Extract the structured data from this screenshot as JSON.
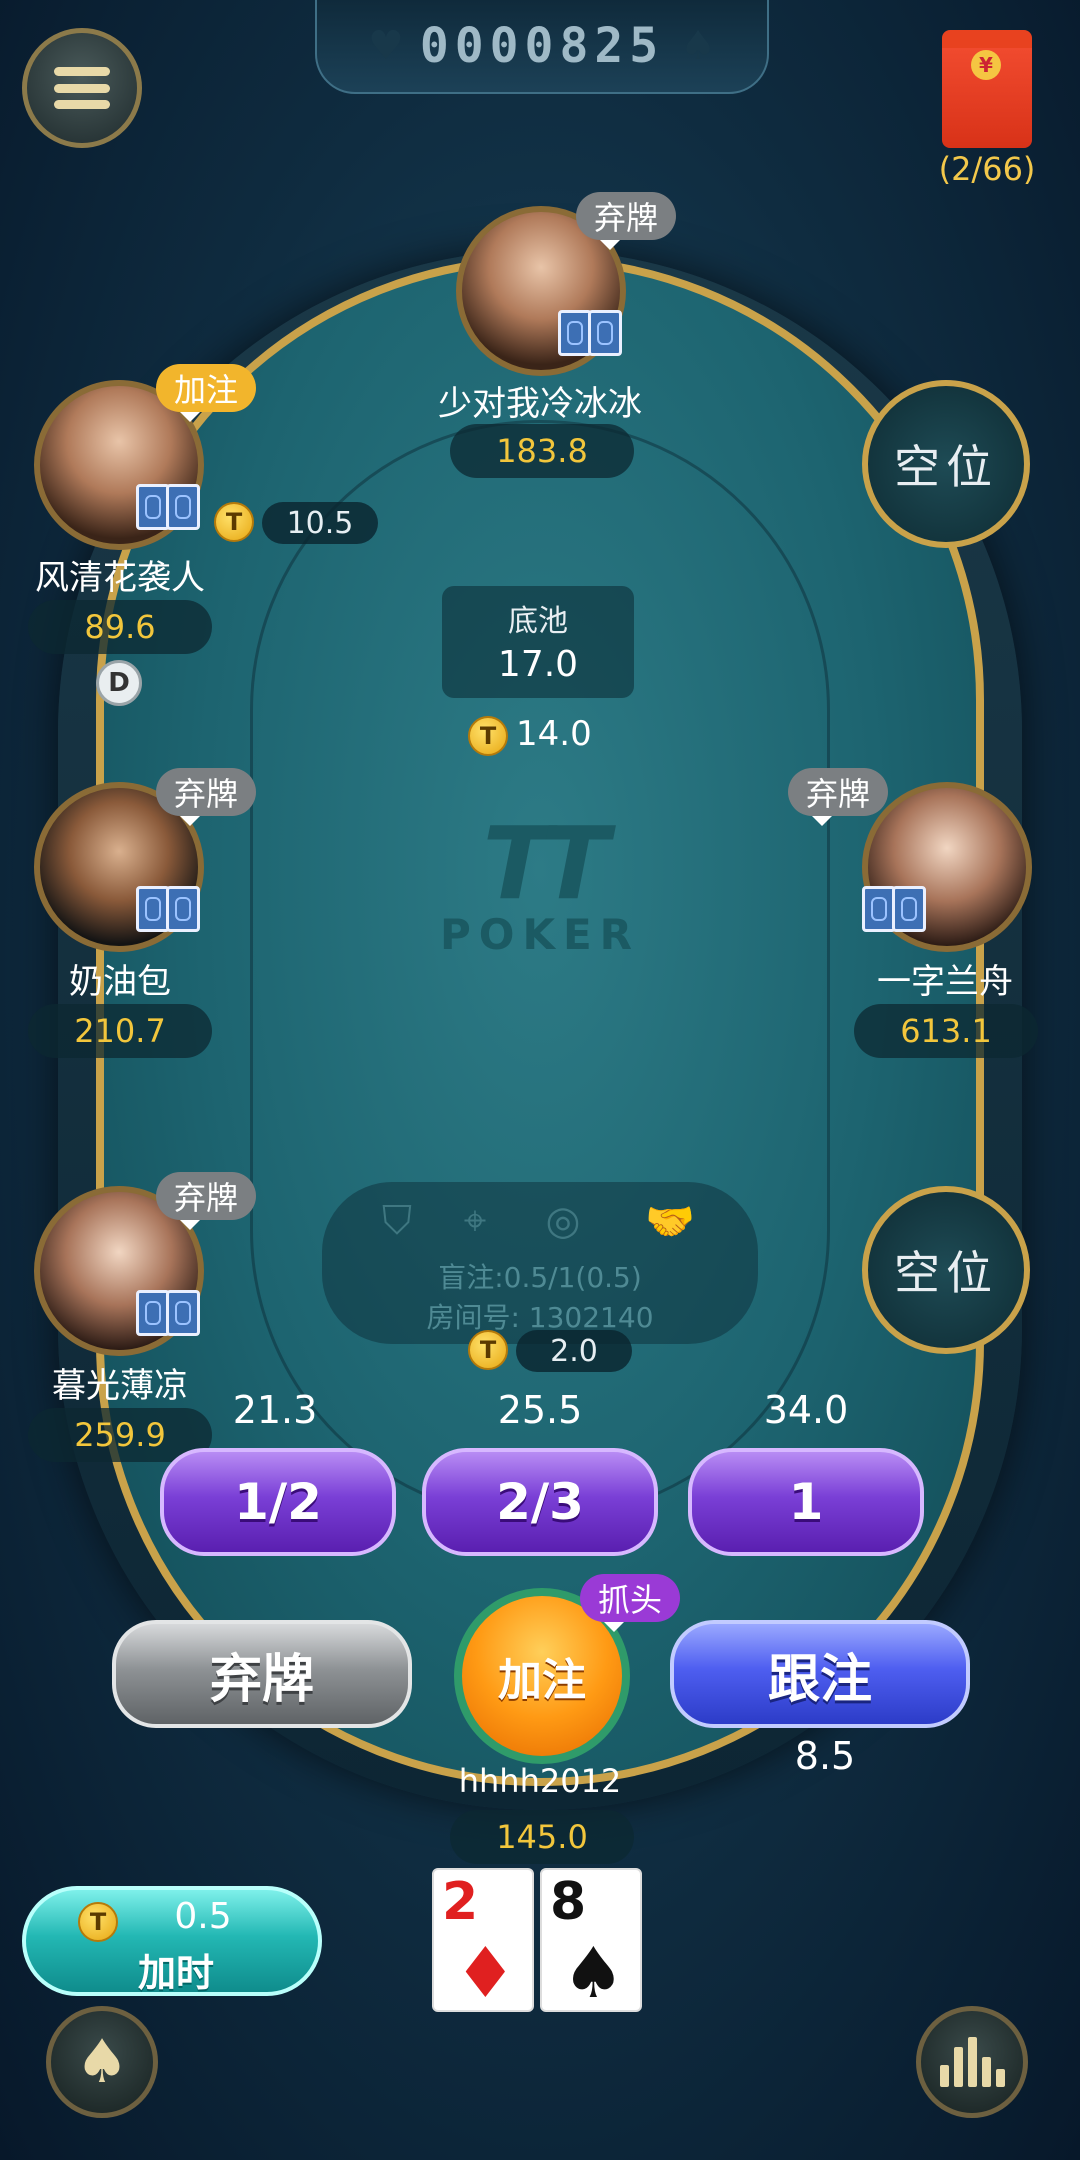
{
  "header": {
    "room_counter": "0000825",
    "red_packet_count": "(2/66)"
  },
  "seats": {
    "top": {
      "name": "少对我冷冰冰",
      "chips": "183.8",
      "status": "弃牌"
    },
    "left1": {
      "name": "风清花袭人",
      "chips": "89.6",
      "status": "加注",
      "bet": "10.5",
      "dealer": "D"
    },
    "left2": {
      "name": "奶油包",
      "chips": "210.7",
      "status": "弃牌"
    },
    "left3": {
      "name": "暮光薄凉",
      "chips": "259.9",
      "status": "弃牌"
    },
    "right2": {
      "name": "一字兰舟",
      "chips": "613.1",
      "status": "弃牌"
    },
    "empty_label": "空位"
  },
  "pot": {
    "label": "底池",
    "value": "17.0",
    "current_bet": "14.0"
  },
  "logo": {
    "tt": "TT",
    "poker": "POKER"
  },
  "room_info": {
    "blinds": "盲注:0.5/1(0.5)",
    "room_number": "房间号: 1302140"
  },
  "my_bet": "2.0",
  "raise_options": [
    {
      "label": "1/2",
      "amount": "21.3"
    },
    {
      "label": "2/3",
      "amount": "25.5"
    },
    {
      "label": "1",
      "amount": "34.0"
    }
  ],
  "actions": {
    "fold": "弃牌",
    "raise": "加注",
    "raise_badge": "抓头",
    "call": "跟注",
    "call_amount": "8.5"
  },
  "me": {
    "name": "hhhh2012",
    "chips": "145.0",
    "cards": [
      {
        "rank": "2",
        "suit": "♦",
        "color": "#e02020"
      },
      {
        "rank": "8",
        "suit": "♠",
        "color": "#111111"
      }
    ]
  },
  "time_button": {
    "cost": "0.5",
    "label": "加时"
  },
  "colors": {
    "accent_gold": "#c9a24a",
    "chips_yellow": "#f2c63c",
    "table_felt": "#1d6470"
  }
}
